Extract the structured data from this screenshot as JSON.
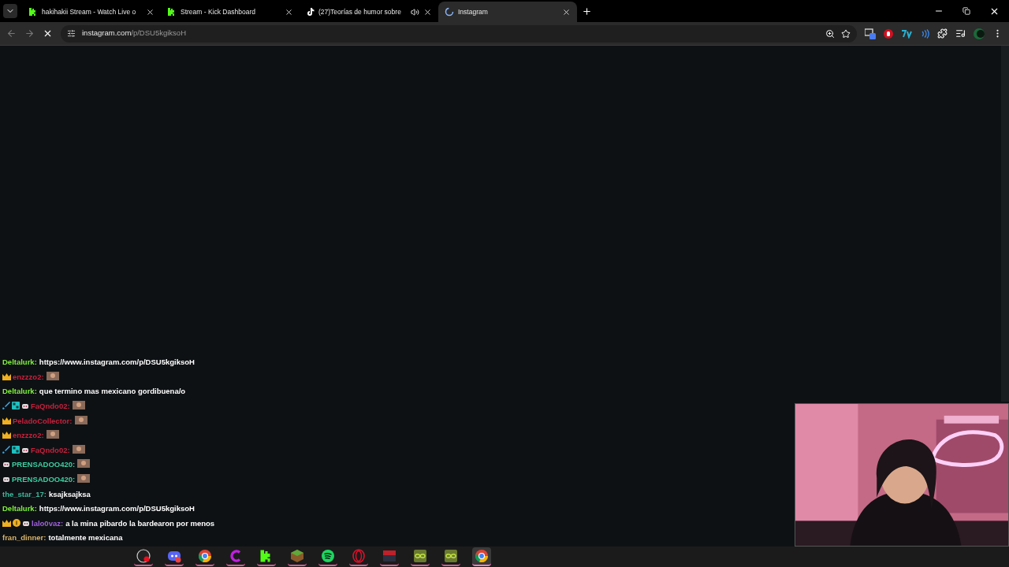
{
  "tabs": [
    {
      "title": "hakihakii Stream - Watch Live o",
      "kind": "kick",
      "selected": false,
      "audio": false
    },
    {
      "title": "Stream - Kick Dashboard",
      "kind": "kick",
      "selected": false,
      "audio": false
    },
    {
      "title": "(27)Teorías de humor sobre",
      "kind": "tiktok",
      "selected": false,
      "audio": true
    },
    {
      "title": "Instagram",
      "kind": "loading",
      "selected": true,
      "audio": false
    }
  ],
  "address_bar": {
    "host": "instagram.com",
    "path": "/p/DSU5kgiksoH"
  },
  "chat": [
    {
      "user": "Deltalurk:",
      "color": "#7ef03c",
      "kind": "text",
      "text": "https://www.instagram.com/p/DSU5kgiksoH"
    },
    {
      "user": "enzzzo2:",
      "color": "#c8203c",
      "kind": "emote",
      "badges": [
        {
          "kind": "crown"
        }
      ]
    },
    {
      "user": "Deltalurk:",
      "color": "#7ef03c",
      "kind": "text",
      "text": "que termino mas mexicano gordibuena/o"
    },
    {
      "user": "FaQndo02:",
      "color": "#c8203c",
      "kind": "emote",
      "badges": [
        {
          "kind": "sword"
        },
        {
          "kind": "og"
        },
        {
          "kind": "bot"
        }
      ]
    },
    {
      "user": "PeladoCollector:",
      "color": "#c8203c",
      "kind": "emote",
      "badges": [
        {
          "kind": "crown"
        }
      ]
    },
    {
      "user": "enzzzo2:",
      "color": "#c8203c",
      "kind": "emote",
      "badges": [
        {
          "kind": "crown"
        }
      ]
    },
    {
      "user": "FaQndo02:",
      "color": "#c8203c",
      "kind": "emote",
      "badges": [
        {
          "kind": "sword"
        },
        {
          "kind": "og"
        },
        {
          "kind": "bot"
        }
      ]
    },
    {
      "user": "PRENSADOO420:",
      "color": "#3ccfa0",
      "kind": "emote",
      "badges": [
        {
          "kind": "bot"
        }
      ]
    },
    {
      "user": "PRENSADOO420:",
      "color": "#3ccfa0",
      "kind": "emote",
      "badges": [
        {
          "kind": "bot"
        }
      ]
    },
    {
      "user": "the_star_17:",
      "color": "#3cb89c",
      "kind": "text",
      "text": "ksajksajksa"
    },
    {
      "user": "Deltalurk:",
      "color": "#7ef03c",
      "kind": "text",
      "text": "https://www.instagram.com/p/DSU5kgiksoH"
    },
    {
      "user": "lalo0vaz:",
      "color": "#a060e0",
      "kind": "text",
      "text": "a la mina pibardo la bardearon por menos",
      "badges": [
        {
          "kind": "crown"
        },
        {
          "kind": "coin"
        },
        {
          "kind": "bot"
        }
      ]
    },
    {
      "user": "fran_dinner:",
      "color": "#d9b36a",
      "kind": "text",
      "text": "totalmente mexicana"
    }
  ],
  "taskbar": [
    {
      "kind": "obs",
      "active": false
    },
    {
      "kind": "discord",
      "active": false
    },
    {
      "kind": "chrome",
      "active": false
    },
    {
      "kind": "c",
      "active": false
    },
    {
      "kind": "kick",
      "active": false
    },
    {
      "kind": "block",
      "active": false
    },
    {
      "kind": "spotify",
      "active": false
    },
    {
      "kind": "opera",
      "active": false
    },
    {
      "kind": "voice",
      "active": false
    },
    {
      "kind": "loop",
      "active": false
    },
    {
      "kind": "loop",
      "active": false
    },
    {
      "kind": "chrome",
      "active": true
    }
  ]
}
